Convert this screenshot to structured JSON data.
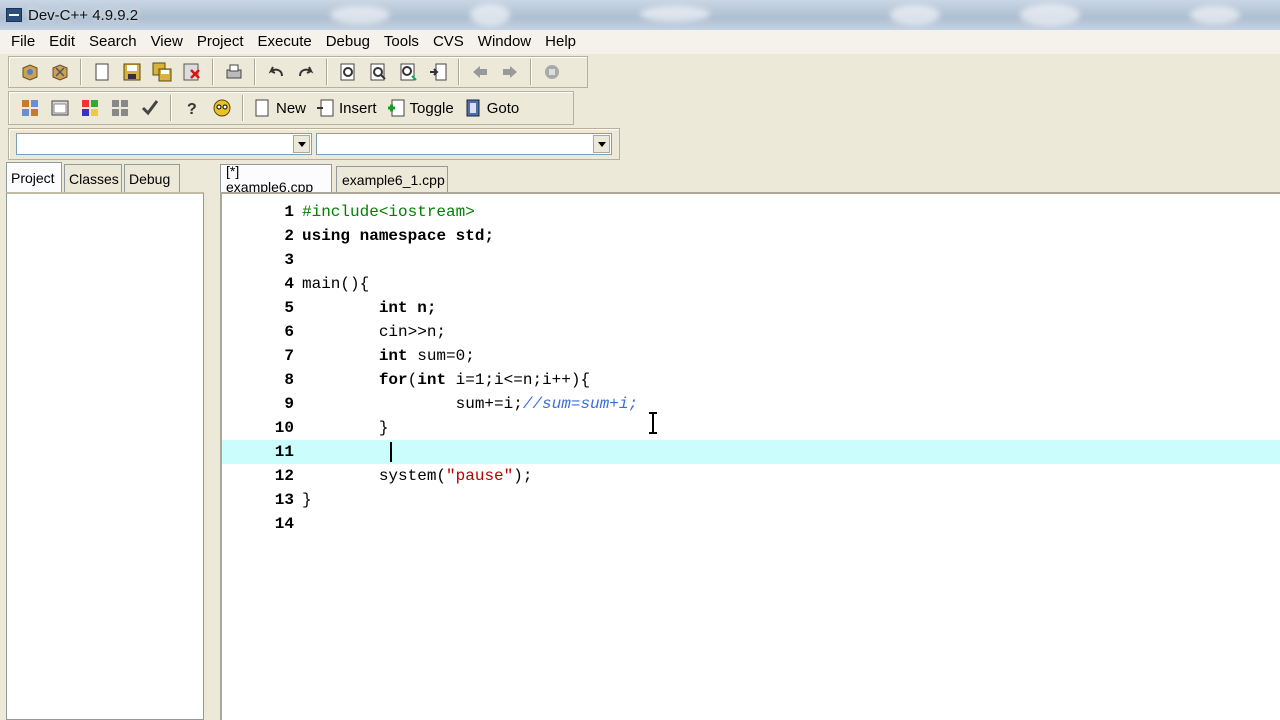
{
  "window": {
    "title": "Dev-C++ 4.9.9.2"
  },
  "menu": [
    "File",
    "Edit",
    "Search",
    "View",
    "Project",
    "Execute",
    "Debug",
    "Tools",
    "CVS",
    "Window",
    "Help"
  ],
  "toolbar2": {
    "new_label": "New",
    "insert_label": "Insert",
    "toggle_label": "Toggle",
    "goto_label": "Goto"
  },
  "left_tabs": [
    "Project",
    "Classes",
    "Debug"
  ],
  "editor_tabs": [
    "[*] example6.cpp",
    "example6_1.cpp"
  ],
  "code": {
    "current_line": 11,
    "lines": [
      {
        "n": "1",
        "text": "#include<iostream>"
      },
      {
        "n": "2",
        "text": "using namespace std;"
      },
      {
        "n": "3",
        "text": ""
      },
      {
        "n": "4",
        "text": "main(){"
      },
      {
        "n": "5",
        "text": "        int n;"
      },
      {
        "n": "6",
        "text": "        cin>>n;"
      },
      {
        "n": "7",
        "text": "        int sum=0;"
      },
      {
        "n": "8",
        "text": "        for(int i=1;i<=n;i++){"
      },
      {
        "n": "9",
        "text": "                sum+=i;//sum=sum+i;"
      },
      {
        "n": "10",
        "text": "        }"
      },
      {
        "n": "11",
        "text": ""
      },
      {
        "n": "12",
        "text": "        system(\"pause\");"
      },
      {
        "n": "13",
        "text": "}"
      },
      {
        "n": "14",
        "text": ""
      }
    ]
  }
}
